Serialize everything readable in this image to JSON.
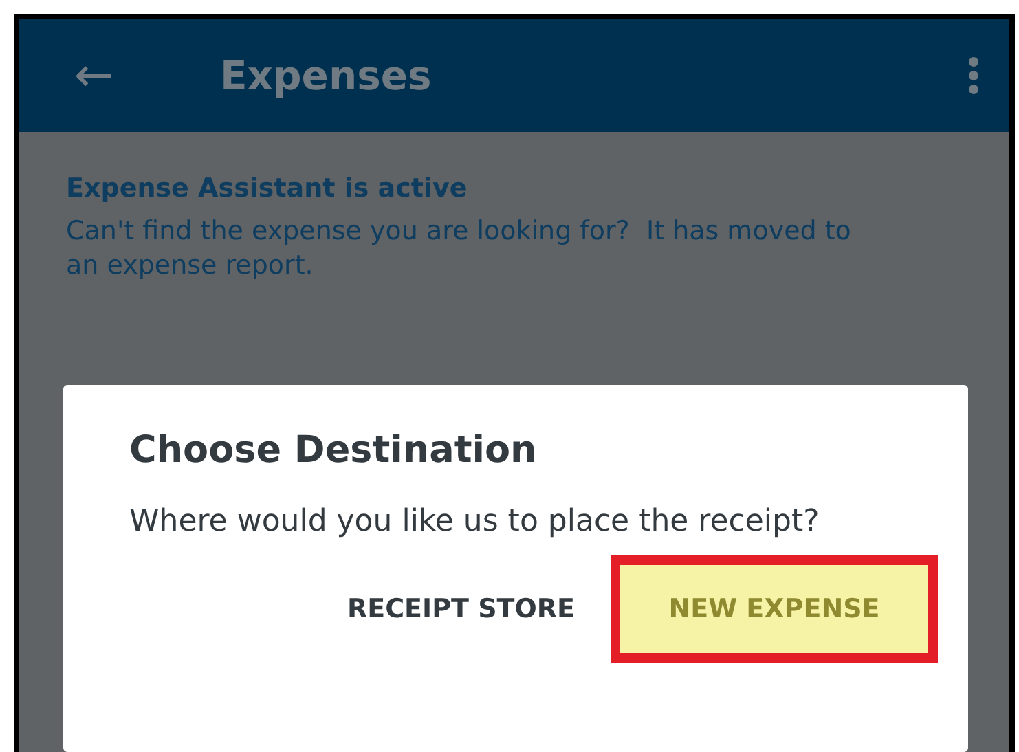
{
  "app_bar": {
    "back": "←",
    "title": "Expenses"
  },
  "banner": {
    "heading": "Expense Assistant is active",
    "message": "Can't find the expense you are looking for?  It has moved to an expense report."
  },
  "dialog": {
    "title": "Choose Destination",
    "message": "Where would you like us to place the receipt?",
    "buttons": [
      {
        "label": "RECEIPT STORE",
        "highlighted": false
      },
      {
        "label": "NEW EXPENSE",
        "highlighted": true
      }
    ]
  }
}
